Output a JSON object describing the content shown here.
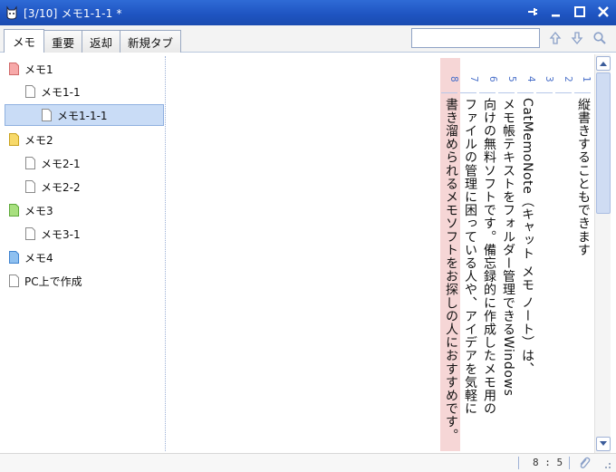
{
  "window": {
    "title": "[3/10] メモ1-1-1 *",
    "controls": [
      "pin-icon",
      "minimize-icon",
      "maximize-icon",
      "close-icon"
    ]
  },
  "tabs": [
    {
      "label": "メモ",
      "active": true
    },
    {
      "label": "重要",
      "active": false
    },
    {
      "label": "返却",
      "active": false
    },
    {
      "label": "新規タブ",
      "active": false
    }
  ],
  "search": {
    "value": "",
    "placeholder": ""
  },
  "toolbar_icons": [
    "arrow-up-icon",
    "arrow-down-icon",
    "search-icon"
  ],
  "tree": [
    {
      "label": "メモ1",
      "color": "#ef7f7f",
      "level": 0
    },
    {
      "label": "メモ1-1",
      "color": "#ffffff",
      "level": 1
    },
    {
      "label": "メモ1-1-1",
      "color": "#ffffff",
      "level": 2,
      "selected": true
    },
    {
      "label": "メモ2",
      "color": "#f3c64a",
      "level": 0
    },
    {
      "label": "メモ2-1",
      "color": "#ffffff",
      "level": 1
    },
    {
      "label": "メモ2-2",
      "color": "#ffffff",
      "level": 1
    },
    {
      "label": "メモ3",
      "color": "#8fd46a",
      "level": 0
    },
    {
      "label": "メモ3-1",
      "color": "#ffffff",
      "level": 1
    },
    {
      "label": "メモ4",
      "color": "#6aa8e8",
      "level": 0
    },
    {
      "label": "PC上で作成",
      "color": "#ffffff",
      "level": 0
    }
  ],
  "editor": {
    "lines": [
      {
        "num": "1",
        "text": "縦書きすることもできます"
      },
      {
        "num": "2",
        "text": ""
      },
      {
        "num": "3",
        "text": ""
      },
      {
        "num": "4",
        "text": "CatMemoNote（キャット メモ ノート）は、"
      },
      {
        "num": "5",
        "text": "メモ帳テキストをフォルダー管理できるWindows"
      },
      {
        "num": "6",
        "text": "向けの無料ソフトです。備忘録的に作成したメモ用の"
      },
      {
        "num": "7",
        "text": "ファイルの管理に困っている人や、アイデアを気軽に"
      },
      {
        "num": "8",
        "text": "書き溜められるメモソフトをお探しの人におすすめです。"
      }
    ],
    "current_line": "8",
    "highlight_color": "#f6d6d6"
  },
  "status": {
    "position": "8 : 5",
    "icons": [
      "paperclip-icon",
      "resize-grip-icon"
    ]
  }
}
